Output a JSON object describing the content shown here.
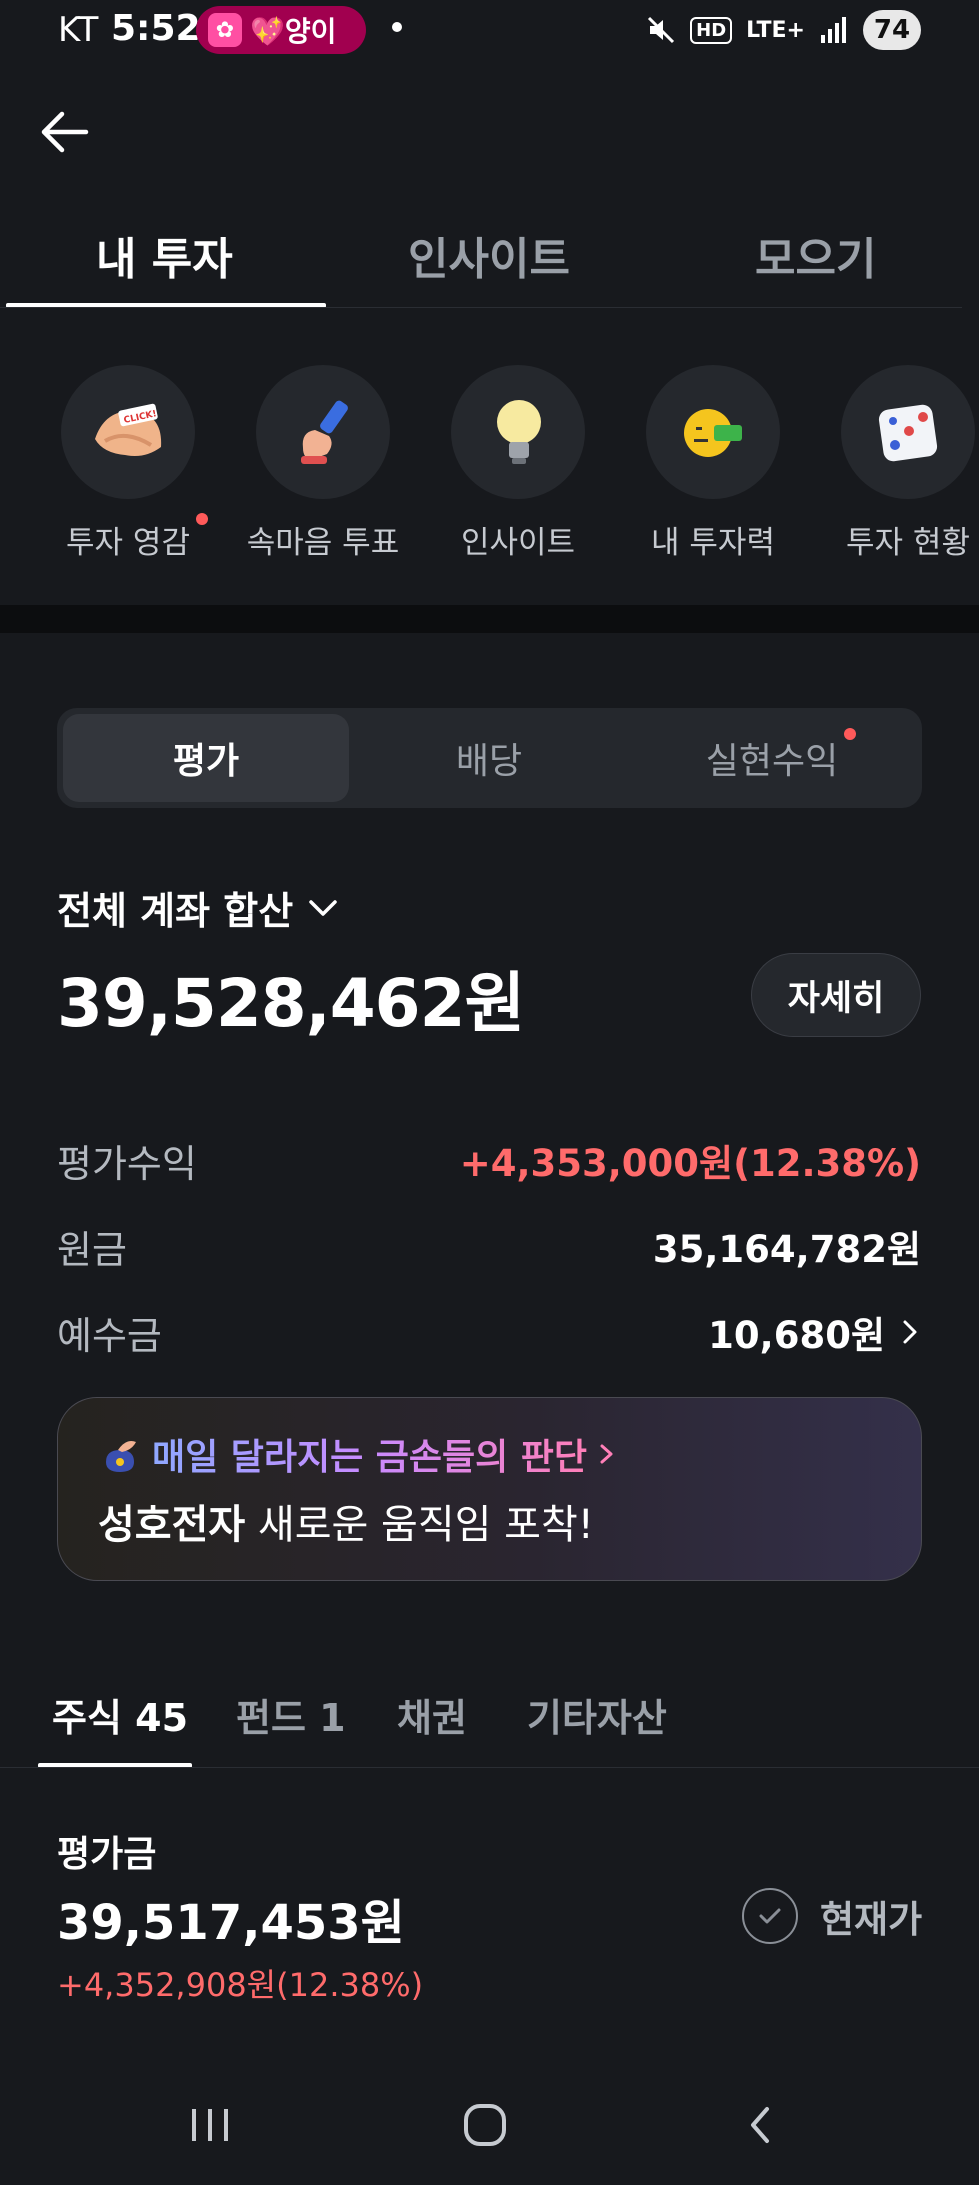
{
  "status_bar": {
    "carrier": "KT",
    "time": "5:52",
    "notification_text": "💖양이",
    "network": "LTE+",
    "hd": "HD",
    "battery": "74"
  },
  "top_tabs": [
    {
      "label": "내 투자",
      "active": true
    },
    {
      "label": "인사이트",
      "active": false
    },
    {
      "label": "모으기",
      "active": false
    }
  ],
  "shortcuts": [
    {
      "label": "투자 영감",
      "icon": "fortune-cookie-icon",
      "badge": true
    },
    {
      "label": "속마음 투표",
      "icon": "vote-hand-icon",
      "badge": false
    },
    {
      "label": "인사이트",
      "icon": "lightbulb-icon",
      "badge": false
    },
    {
      "label": "내 투자력",
      "icon": "emoji-ticket-icon",
      "badge": false
    },
    {
      "label": "투자 현황",
      "icon": "dice-icon",
      "badge": false
    }
  ],
  "segments": [
    {
      "label": "평가",
      "active": true
    },
    {
      "label": "배당",
      "active": false
    },
    {
      "label": "실현수익",
      "active": false,
      "badge": true
    }
  ],
  "account": {
    "title": "전체 계좌 합산",
    "total": "39,528,462원",
    "detail_button": "자세히"
  },
  "summary_rows": {
    "profit": {
      "label": "평가수익",
      "value": "+4,353,000원(12.38%)"
    },
    "principal": {
      "label": "원금",
      "value": "35,164,782원"
    },
    "deposit": {
      "label": "예수금",
      "value": "10,680원"
    }
  },
  "banner": {
    "headline": "매일 달라지는 금손들의 판단",
    "company": "성호전자",
    "message": "새로운 움직임 포착!"
  },
  "asset_tabs": [
    {
      "label": "주식 45",
      "active": true
    },
    {
      "label": "펀드 1",
      "active": false
    },
    {
      "label": "채권",
      "active": false
    },
    {
      "label": "기타자산",
      "active": false
    }
  ],
  "evaluation": {
    "label": "평가금",
    "amount": "39,517,453원",
    "change": "+4,352,908원(12.38%)",
    "toggle_label": "현재가"
  },
  "colors": {
    "background": "#17191d",
    "accent_red": "#ff6b6b",
    "surface": "#25282d"
  }
}
